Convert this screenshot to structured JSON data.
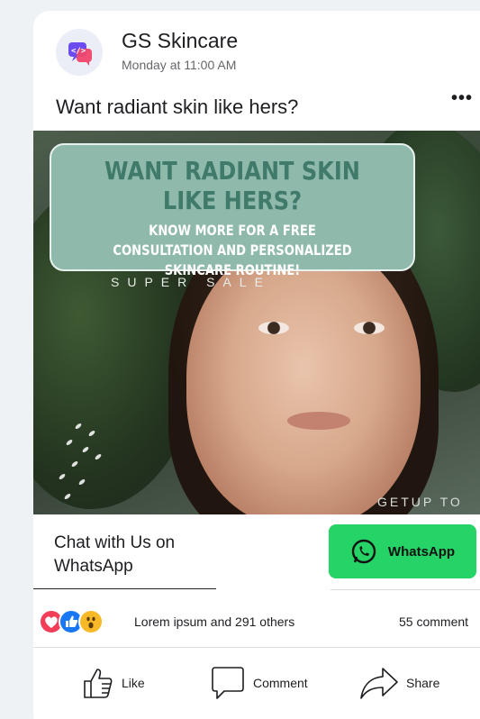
{
  "post": {
    "page_name": "GS Skincare",
    "time": "Monday at 11:00 AM",
    "more": "•••",
    "caption": "Want radiant skin like hers?"
  },
  "ad": {
    "title": "WANT RADIANT SKIN LIKE HERS?",
    "subtitle": "KNOW MORE FOR A FREE\nCONSULTATION AND PERSONALIZED\nSKINCARE ROUTINE!",
    "super_sale": "SUPER SALE",
    "getup": "GETUP TO"
  },
  "cta": {
    "text": "Chat with Us on WhatsApp",
    "button_label": "WhatsApp",
    "button_color": "#25d366"
  },
  "engagement": {
    "reactions": [
      "love-icon",
      "like-icon",
      "wow-icon"
    ],
    "reaction_text": "Lorem ipsum and  291 others",
    "comments": "55 comment"
  },
  "actions": {
    "like": "Like",
    "comment": "Comment",
    "share": "Share"
  },
  "colors": {
    "accent": "#1877f2",
    "love": "#f33e58",
    "wow": "#f7b928",
    "banner": "#8fb9ab",
    "banner_title": "#3f7a6a"
  }
}
